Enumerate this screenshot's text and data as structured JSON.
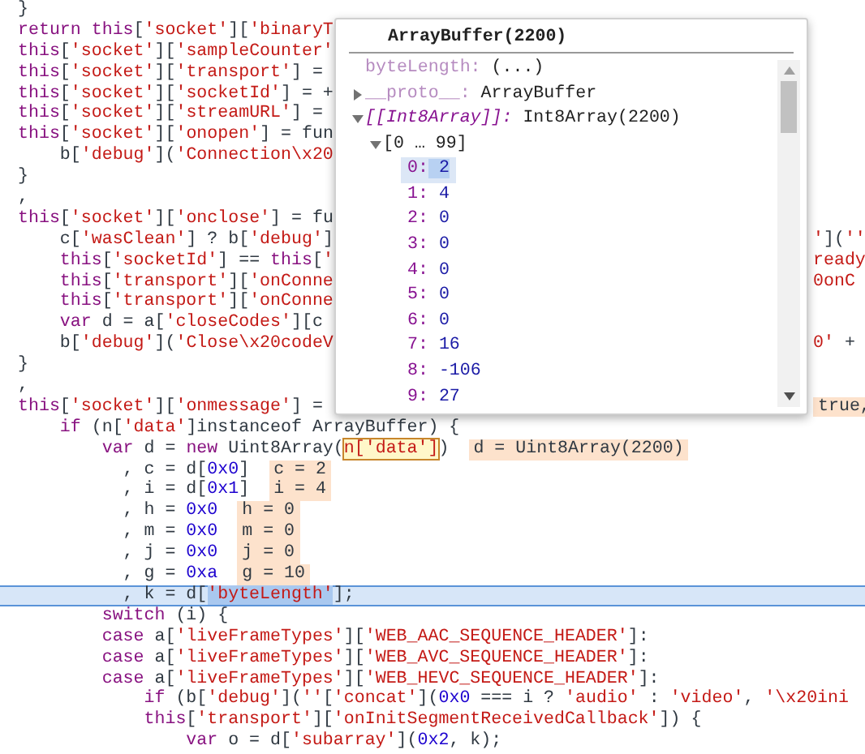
{
  "code_lines": [
    {
      "current": false,
      "tokens": [
        {
          "kind": "plain",
          "text": "}"
        }
      ]
    },
    {
      "current": false,
      "tokens": [
        {
          "kind": "keyword",
          "text": "return this"
        },
        {
          "kind": "plain",
          "text": "["
        },
        {
          "kind": "string",
          "text": "'socket'"
        },
        {
          "kind": "plain",
          "text": "]["
        },
        {
          "kind": "string",
          "text": "'binaryT"
        }
      ]
    },
    {
      "current": false,
      "tokens": [
        {
          "kind": "keyword",
          "text": "this"
        },
        {
          "kind": "plain",
          "text": "["
        },
        {
          "kind": "string",
          "text": "'socket'"
        },
        {
          "kind": "plain",
          "text": "]["
        },
        {
          "kind": "string",
          "text": "'sampleCounter'"
        }
      ]
    },
    {
      "current": false,
      "tokens": [
        {
          "kind": "keyword",
          "text": "this"
        },
        {
          "kind": "plain",
          "text": "["
        },
        {
          "kind": "string",
          "text": "'socket'"
        },
        {
          "kind": "plain",
          "text": "]["
        },
        {
          "kind": "string",
          "text": "'transport'"
        },
        {
          "kind": "plain",
          "text": "] ="
        }
      ]
    },
    {
      "current": false,
      "tokens": [
        {
          "kind": "keyword",
          "text": "this"
        },
        {
          "kind": "plain",
          "text": "["
        },
        {
          "kind": "string",
          "text": "'socket'"
        },
        {
          "kind": "plain",
          "text": "]["
        },
        {
          "kind": "string",
          "text": "'socketId'"
        },
        {
          "kind": "plain",
          "text": "] = +"
        }
      ]
    },
    {
      "current": false,
      "tokens": [
        {
          "kind": "keyword",
          "text": "this"
        },
        {
          "kind": "plain",
          "text": "["
        },
        {
          "kind": "string",
          "text": "'socket'"
        },
        {
          "kind": "plain",
          "text": "]["
        },
        {
          "kind": "string",
          "text": "'streamURL'"
        },
        {
          "kind": "plain",
          "text": "] ="
        }
      ]
    },
    {
      "current": false,
      "tokens": [
        {
          "kind": "keyword",
          "text": "this"
        },
        {
          "kind": "plain",
          "text": "["
        },
        {
          "kind": "string",
          "text": "'socket'"
        },
        {
          "kind": "plain",
          "text": "]["
        },
        {
          "kind": "string",
          "text": "'onopen'"
        },
        {
          "kind": "plain",
          "text": "] = fun"
        }
      ]
    },
    {
      "current": false,
      "tokens": [
        {
          "kind": "plain",
          "text": "    b["
        },
        {
          "kind": "string",
          "text": "'debug'"
        },
        {
          "kind": "plain",
          "text": "]("
        },
        {
          "kind": "string",
          "text": "'Connection\\x20"
        }
      ]
    },
    {
      "current": false,
      "tokens": [
        {
          "kind": "plain",
          "text": "}"
        }
      ]
    },
    {
      "current": false,
      "tokens": [
        {
          "kind": "plain",
          "text": ","
        }
      ]
    },
    {
      "current": false,
      "tokens": [
        {
          "kind": "keyword",
          "text": "this"
        },
        {
          "kind": "plain",
          "text": "["
        },
        {
          "kind": "string",
          "text": "'socket'"
        },
        {
          "kind": "plain",
          "text": "]["
        },
        {
          "kind": "string",
          "text": "'onclose'"
        },
        {
          "kind": "plain",
          "text": "] = fu"
        }
      ]
    },
    {
      "current": false,
      "tokens": [
        {
          "kind": "plain",
          "text": "    c["
        },
        {
          "kind": "string",
          "text": "'wasClean'"
        },
        {
          "kind": "plain",
          "text": "] ? b["
        },
        {
          "kind": "string",
          "text": "'debug'"
        },
        {
          "kind": "plain",
          "text": "]"
        }
      ],
      "right": [
        {
          "kind": "string",
          "text": "'"
        },
        {
          "kind": "plain",
          "text": "]("
        },
        {
          "kind": "string",
          "text": "''"
        }
      ]
    },
    {
      "current": false,
      "tokens": [
        {
          "kind": "keyword",
          "text": "    this"
        },
        {
          "kind": "plain",
          "text": "["
        },
        {
          "kind": "string",
          "text": "'socketId'"
        },
        {
          "kind": "plain",
          "text": "] == "
        },
        {
          "kind": "keyword",
          "text": "this"
        },
        {
          "kind": "plain",
          "text": "["
        },
        {
          "kind": "string",
          "text": "'"
        }
      ],
      "right": [
        {
          "kind": "string",
          "text": "ready"
        }
      ]
    },
    {
      "current": false,
      "tokens": [
        {
          "kind": "keyword",
          "text": "    this"
        },
        {
          "kind": "plain",
          "text": "["
        },
        {
          "kind": "string",
          "text": "'transport'"
        },
        {
          "kind": "plain",
          "text": "]["
        },
        {
          "kind": "string",
          "text": "'onConne"
        }
      ],
      "right": [
        {
          "kind": "string",
          "text": "0onC"
        }
      ]
    },
    {
      "current": false,
      "tokens": [
        {
          "kind": "keyword",
          "text": "    this"
        },
        {
          "kind": "plain",
          "text": "["
        },
        {
          "kind": "string",
          "text": "'transport'"
        },
        {
          "kind": "plain",
          "text": "]["
        },
        {
          "kind": "string",
          "text": "'onConne"
        }
      ]
    },
    {
      "current": false,
      "tokens": [
        {
          "kind": "keyword",
          "text": "    var"
        },
        {
          "kind": "plain",
          "text": " d = a["
        },
        {
          "kind": "string",
          "text": "'closeCodes'"
        },
        {
          "kind": "plain",
          "text": "][c"
        }
      ]
    },
    {
      "current": false,
      "tokens": [
        {
          "kind": "plain",
          "text": "    b["
        },
        {
          "kind": "string",
          "text": "'debug'"
        },
        {
          "kind": "plain",
          "text": "]("
        },
        {
          "kind": "string",
          "text": "'Close\\x20codeV"
        }
      ],
      "right": [
        {
          "kind": "string",
          "text": "0'"
        },
        {
          "kind": "plain",
          "text": " +"
        }
      ]
    },
    {
      "current": false,
      "tokens": [
        {
          "kind": "plain",
          "text": "}"
        }
      ]
    },
    {
      "current": false,
      "tokens": [
        {
          "kind": "plain",
          "text": ","
        }
      ]
    },
    {
      "current": false,
      "tokens": [
        {
          "kind": "keyword",
          "text": "this"
        },
        {
          "kind": "plain",
          "text": "["
        },
        {
          "kind": "string",
          "text": "'socket'"
        },
        {
          "kind": "plain",
          "text": "]["
        },
        {
          "kind": "string",
          "text": "'onmessage'"
        },
        {
          "kind": "plain",
          "text": "] ="
        }
      ],
      "right": [
        {
          "kind": "value",
          "text": "true,"
        }
      ]
    },
    {
      "current": false,
      "tokens": [
        {
          "kind": "keyword",
          "text": "    if"
        },
        {
          "kind": "plain",
          "text": " (n["
        },
        {
          "kind": "string",
          "text": "'data'"
        },
        {
          "kind": "plain",
          "text": "]instanceof ArrayBuffer) {"
        }
      ]
    },
    {
      "current": false,
      "tokens": [
        {
          "kind": "keyword",
          "text": "        var"
        },
        {
          "kind": "plain",
          "text": " d = "
        },
        {
          "kind": "keyword",
          "text": "new"
        },
        {
          "kind": "plain",
          "text": " Uint8Array("
        },
        {
          "kind": "hover",
          "text": "n['data']"
        },
        {
          "kind": "plain",
          "text": ")"
        }
      ],
      "values": [
        "d = Uint8Array(2200)"
      ]
    },
    {
      "current": false,
      "tokens": [
        {
          "kind": "plain",
          "text": "          , c = d["
        },
        {
          "kind": "number",
          "text": "0x0"
        },
        {
          "kind": "plain",
          "text": "]"
        }
      ],
      "values": [
        "c = 2"
      ]
    },
    {
      "current": false,
      "tokens": [
        {
          "kind": "plain",
          "text": "          , i = d["
        },
        {
          "kind": "number",
          "text": "0x1"
        },
        {
          "kind": "plain",
          "text": "]"
        }
      ],
      "values": [
        "i = 4"
      ]
    },
    {
      "current": false,
      "tokens": [
        {
          "kind": "plain",
          "text": "          , h = "
        },
        {
          "kind": "number",
          "text": "0x0"
        }
      ],
      "values": [
        "h = 0"
      ]
    },
    {
      "current": false,
      "tokens": [
        {
          "kind": "plain",
          "text": "          , m = "
        },
        {
          "kind": "number",
          "text": "0x0"
        }
      ],
      "values": [
        "m = 0"
      ]
    },
    {
      "current": false,
      "tokens": [
        {
          "kind": "plain",
          "text": "          , j = "
        },
        {
          "kind": "number",
          "text": "0x0"
        }
      ],
      "values": [
        "j = 0"
      ]
    },
    {
      "current": false,
      "tokens": [
        {
          "kind": "plain",
          "text": "          , g = "
        },
        {
          "kind": "number",
          "text": "0xa"
        }
      ],
      "values": [
        "g = 10"
      ]
    },
    {
      "current": true,
      "tokens": [
        {
          "kind": "plain",
          "text": "          , k = d["
        },
        {
          "kind": "selection",
          "text": "'byteLength'"
        },
        {
          "kind": "plain",
          "text": "];"
        }
      ]
    },
    {
      "current": false,
      "tokens": [
        {
          "kind": "keyword",
          "text": "        switch"
        },
        {
          "kind": "plain",
          "text": " (i) {"
        }
      ]
    },
    {
      "current": false,
      "tokens": [
        {
          "kind": "keyword",
          "text": "        case"
        },
        {
          "kind": "plain",
          "text": " a["
        },
        {
          "kind": "string",
          "text": "'liveFrameTypes'"
        },
        {
          "kind": "plain",
          "text": "]["
        },
        {
          "kind": "string",
          "text": "'WEB_AAC_SEQUENCE_HEADER'"
        },
        {
          "kind": "plain",
          "text": "]:"
        }
      ]
    },
    {
      "current": false,
      "tokens": [
        {
          "kind": "keyword",
          "text": "        case"
        },
        {
          "kind": "plain",
          "text": " a["
        },
        {
          "kind": "string",
          "text": "'liveFrameTypes'"
        },
        {
          "kind": "plain",
          "text": "]["
        },
        {
          "kind": "string",
          "text": "'WEB_AVC_SEQUENCE_HEADER'"
        },
        {
          "kind": "plain",
          "text": "]:"
        }
      ]
    },
    {
      "current": false,
      "tokens": [
        {
          "kind": "keyword",
          "text": "        case"
        },
        {
          "kind": "plain",
          "text": " a["
        },
        {
          "kind": "string",
          "text": "'liveFrameTypes'"
        },
        {
          "kind": "plain",
          "text": "]["
        },
        {
          "kind": "string",
          "text": "'WEB_HEVC_SEQUENCE_HEADER'"
        },
        {
          "kind": "plain",
          "text": "]:"
        }
      ]
    },
    {
      "current": false,
      "tokens": [
        {
          "kind": "keyword",
          "text": "            if"
        },
        {
          "kind": "plain",
          "text": " (b["
        },
        {
          "kind": "string",
          "text": "'debug'"
        },
        {
          "kind": "plain",
          "text": "]("
        },
        {
          "kind": "string",
          "text": "''"
        },
        {
          "kind": "plain",
          "text": "["
        },
        {
          "kind": "string",
          "text": "'concat'"
        },
        {
          "kind": "plain",
          "text": "]("
        },
        {
          "kind": "number",
          "text": "0x0"
        },
        {
          "kind": "plain",
          "text": " === i ? "
        },
        {
          "kind": "string",
          "text": "'audio'"
        },
        {
          "kind": "plain",
          "text": " : "
        },
        {
          "kind": "string",
          "text": "'video'"
        },
        {
          "kind": "plain",
          "text": ", "
        },
        {
          "kind": "string",
          "text": "'\\x20ini"
        }
      ]
    },
    {
      "current": false,
      "tokens": [
        {
          "kind": "keyword",
          "text": "            this"
        },
        {
          "kind": "plain",
          "text": "["
        },
        {
          "kind": "string",
          "text": "'transport'"
        },
        {
          "kind": "plain",
          "text": "]["
        },
        {
          "kind": "string",
          "text": "'onInitSegmentReceivedCallback'"
        },
        {
          "kind": "plain",
          "text": "]) {"
        }
      ]
    },
    {
      "current": false,
      "tokens": [
        {
          "kind": "keyword",
          "text": "                var"
        },
        {
          "kind": "plain",
          "text": " o = d["
        },
        {
          "kind": "string",
          "text": "'subarray'"
        },
        {
          "kind": "plain",
          "text": "]("
        },
        {
          "kind": "number",
          "text": "0x2"
        },
        {
          "kind": "plain",
          "text": ", k);"
        }
      ]
    }
  ],
  "popover": {
    "title": "ArrayBuffer(2200)",
    "items": [
      {
        "kind": "getter",
        "key": "byteLength:",
        "value": "(...)"
      },
      {
        "kind": "proto",
        "key": "__proto__:",
        "value": "ArrayBuffer",
        "expanded": false
      },
      {
        "kind": "internal",
        "key": "[[Int8Array]]:",
        "value": "Int8Array(2200)",
        "expanded": true,
        "children": [
          {
            "kind": "range",
            "key": "[0 … 99]",
            "expanded": true,
            "children": [
              {
                "kind": "entry",
                "key": "0:",
                "value": "2",
                "selected": true
              },
              {
                "kind": "entry",
                "key": "1:",
                "value": "4",
                "selected": false
              },
              {
                "kind": "entry",
                "key": "2:",
                "value": "0",
                "selected": false
              },
              {
                "kind": "entry",
                "key": "3:",
                "value": "0",
                "selected": false
              },
              {
                "kind": "entry",
                "key": "4:",
                "value": "0",
                "selected": false
              },
              {
                "kind": "entry",
                "key": "5:",
                "value": "0",
                "selected": false
              },
              {
                "kind": "entry",
                "key": "6:",
                "value": "0",
                "selected": false
              },
              {
                "kind": "entry",
                "key": "7:",
                "value": "16",
                "selected": false
              },
              {
                "kind": "entry",
                "key": "8:",
                "value": "-106",
                "selected": false
              },
              {
                "kind": "entry",
                "key": "9:",
                "value": "27",
                "selected": false
              }
            ]
          }
        ]
      }
    ]
  }
}
